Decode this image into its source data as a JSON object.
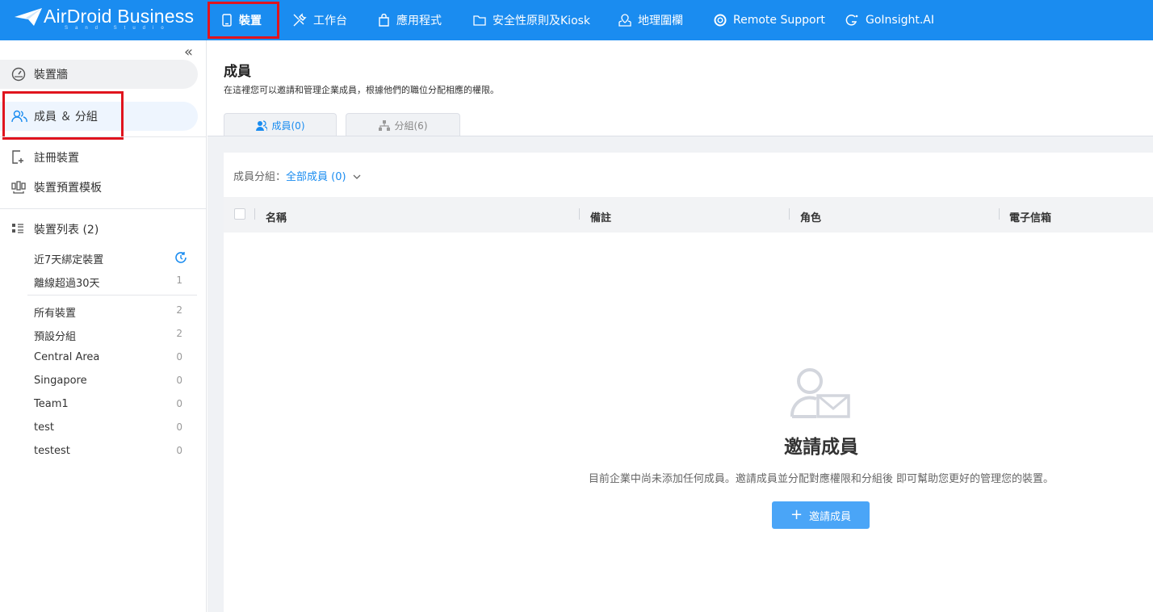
{
  "brand": {
    "name": "AirDroid Business",
    "sub": "Sand Studio"
  },
  "topnav": [
    {
      "label": "裝置",
      "icon": "device-icon"
    },
    {
      "label": "工作台",
      "icon": "tools-icon"
    },
    {
      "label": "應用程式",
      "icon": "app-bag-icon"
    },
    {
      "label": "安全性原則及Kiosk",
      "icon": "folder-icon"
    },
    {
      "label": "地理圍欄",
      "icon": "map-pin-icon"
    },
    {
      "label": "Remote Support",
      "icon": "lifebuoy-icon"
    },
    {
      "label": "GoInsight.AI",
      "icon": "goinsight-icon"
    }
  ],
  "sidebar": {
    "items": [
      {
        "label": "裝置牆",
        "icon": "dashboard-icon"
      },
      {
        "label": "成員 ＆ 分組",
        "icon": "members-icon"
      },
      {
        "label": "註冊裝置",
        "icon": "register-device-icon"
      },
      {
        "label": "裝置預置模板",
        "icon": "template-icon"
      },
      {
        "label": "裝置列表 (2)",
        "icon": "list-icon"
      }
    ],
    "quick": [
      {
        "label": "近7天綁定裝置",
        "icon": "clock-icon"
      },
      {
        "label": "離線超過30天",
        "count": "1"
      }
    ],
    "groups": [
      {
        "label": "所有裝置",
        "count": "2"
      },
      {
        "label": "預設分組",
        "count": "2"
      },
      {
        "label": "Central Area",
        "count": "0"
      },
      {
        "label": "Singapore",
        "count": "0"
      },
      {
        "label": "Team1",
        "count": "0"
      },
      {
        "label": "test",
        "count": "0"
      },
      {
        "label": "testest",
        "count": "0"
      }
    ]
  },
  "main": {
    "title": "成員",
    "description": "在這裡您可以邀請和管理企業成員，根據他們的職位分配相應的權限。",
    "tabs": [
      {
        "label": "成員(0)",
        "active": true
      },
      {
        "label": "分組(6)",
        "active": false
      }
    ],
    "filter": {
      "label": "成員分組：",
      "value": "全部成員 (0)"
    },
    "columns": [
      "名稱",
      "備註",
      "角色",
      "電子信箱"
    ],
    "empty": {
      "title": "邀請成員",
      "description": "目前企業中尚未添加任何成員。邀請成員並分配對應權限和分組後 即可幫助您更好的管理您的裝置。",
      "button": "邀請成員"
    }
  },
  "colors": {
    "brand": "#1a8cf0",
    "highlight": "#e0141e",
    "button": "#4aa5f7"
  }
}
